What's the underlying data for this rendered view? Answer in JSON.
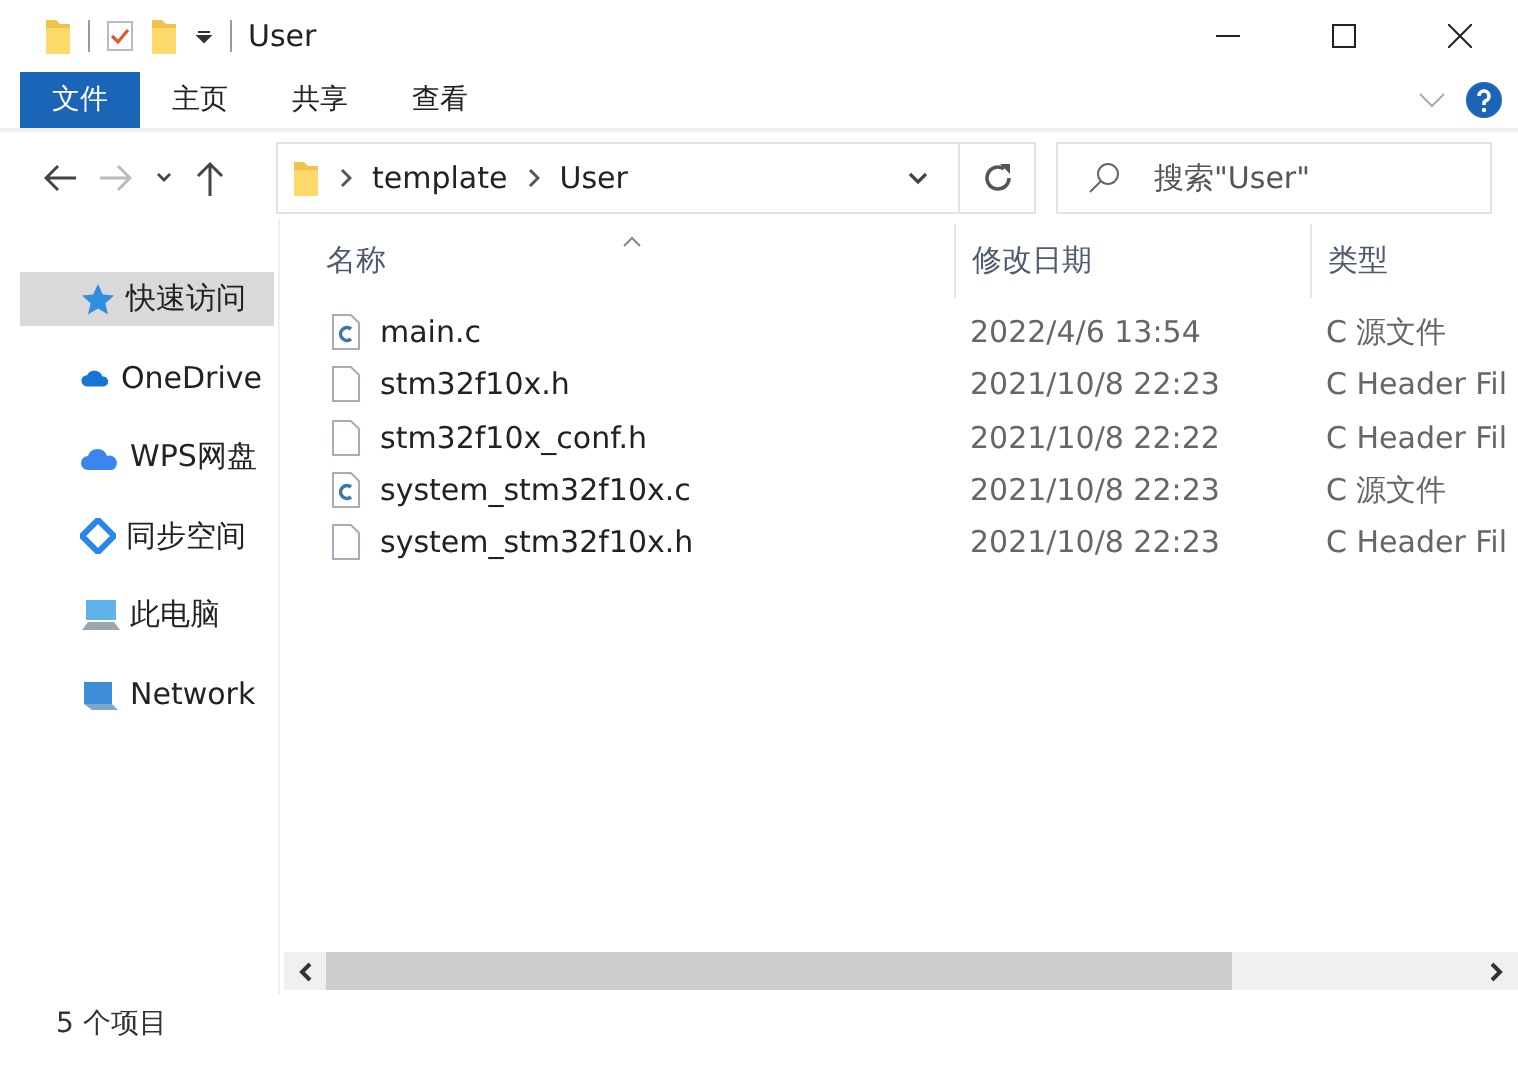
{
  "window": {
    "title": "User"
  },
  "ribbon_tabs": [
    {
      "label": "文件",
      "kind": "file-menu",
      "selected": false
    },
    {
      "label": "主页",
      "kind": "tab",
      "selected": false
    },
    {
      "label": "共享",
      "kind": "tab",
      "selected": false
    },
    {
      "label": "查看",
      "kind": "tab",
      "selected": false
    }
  ],
  "address_bar": {
    "path": [
      "template",
      "User"
    ]
  },
  "search": {
    "placeholder": "搜索\"User\""
  },
  "sidebar": {
    "items": [
      {
        "label": "快速访问",
        "kind": "quick-access",
        "selected": true
      },
      {
        "label": "OneDrive",
        "kind": "onedrive",
        "selected": false
      },
      {
        "label": "WPS网盘",
        "kind": "wps",
        "selected": false
      },
      {
        "label": "同步空间",
        "kind": "sync",
        "selected": false
      },
      {
        "label": "此电脑",
        "kind": "computer",
        "selected": false
      },
      {
        "label": "Network",
        "kind": "network",
        "selected": false
      }
    ]
  },
  "file_list": {
    "columns": [
      "名称",
      "修改日期",
      "类型"
    ],
    "rows": [
      {
        "name": "main.c",
        "kind": "c-source",
        "modified": "2022/4/6 13:54",
        "type": "C 源文件"
      },
      {
        "name": "stm32f10x.h",
        "kind": "header",
        "modified": "2021/10/8 22:23",
        "type": "C Header Fil"
      },
      {
        "name": "stm32f10x_conf.h",
        "kind": "header",
        "modified": "2021/10/8 22:22",
        "type": "C Header Fil"
      },
      {
        "name": "system_stm32f10x.c",
        "kind": "c-source",
        "modified": "2021/10/8 22:23",
        "type": "C 源文件"
      },
      {
        "name": "system_stm32f10x.h",
        "kind": "header",
        "modified": "2021/10/8 22:23",
        "type": "C Header Fil"
      }
    ]
  },
  "status_bar": {
    "item_count": "5 个项目"
  }
}
